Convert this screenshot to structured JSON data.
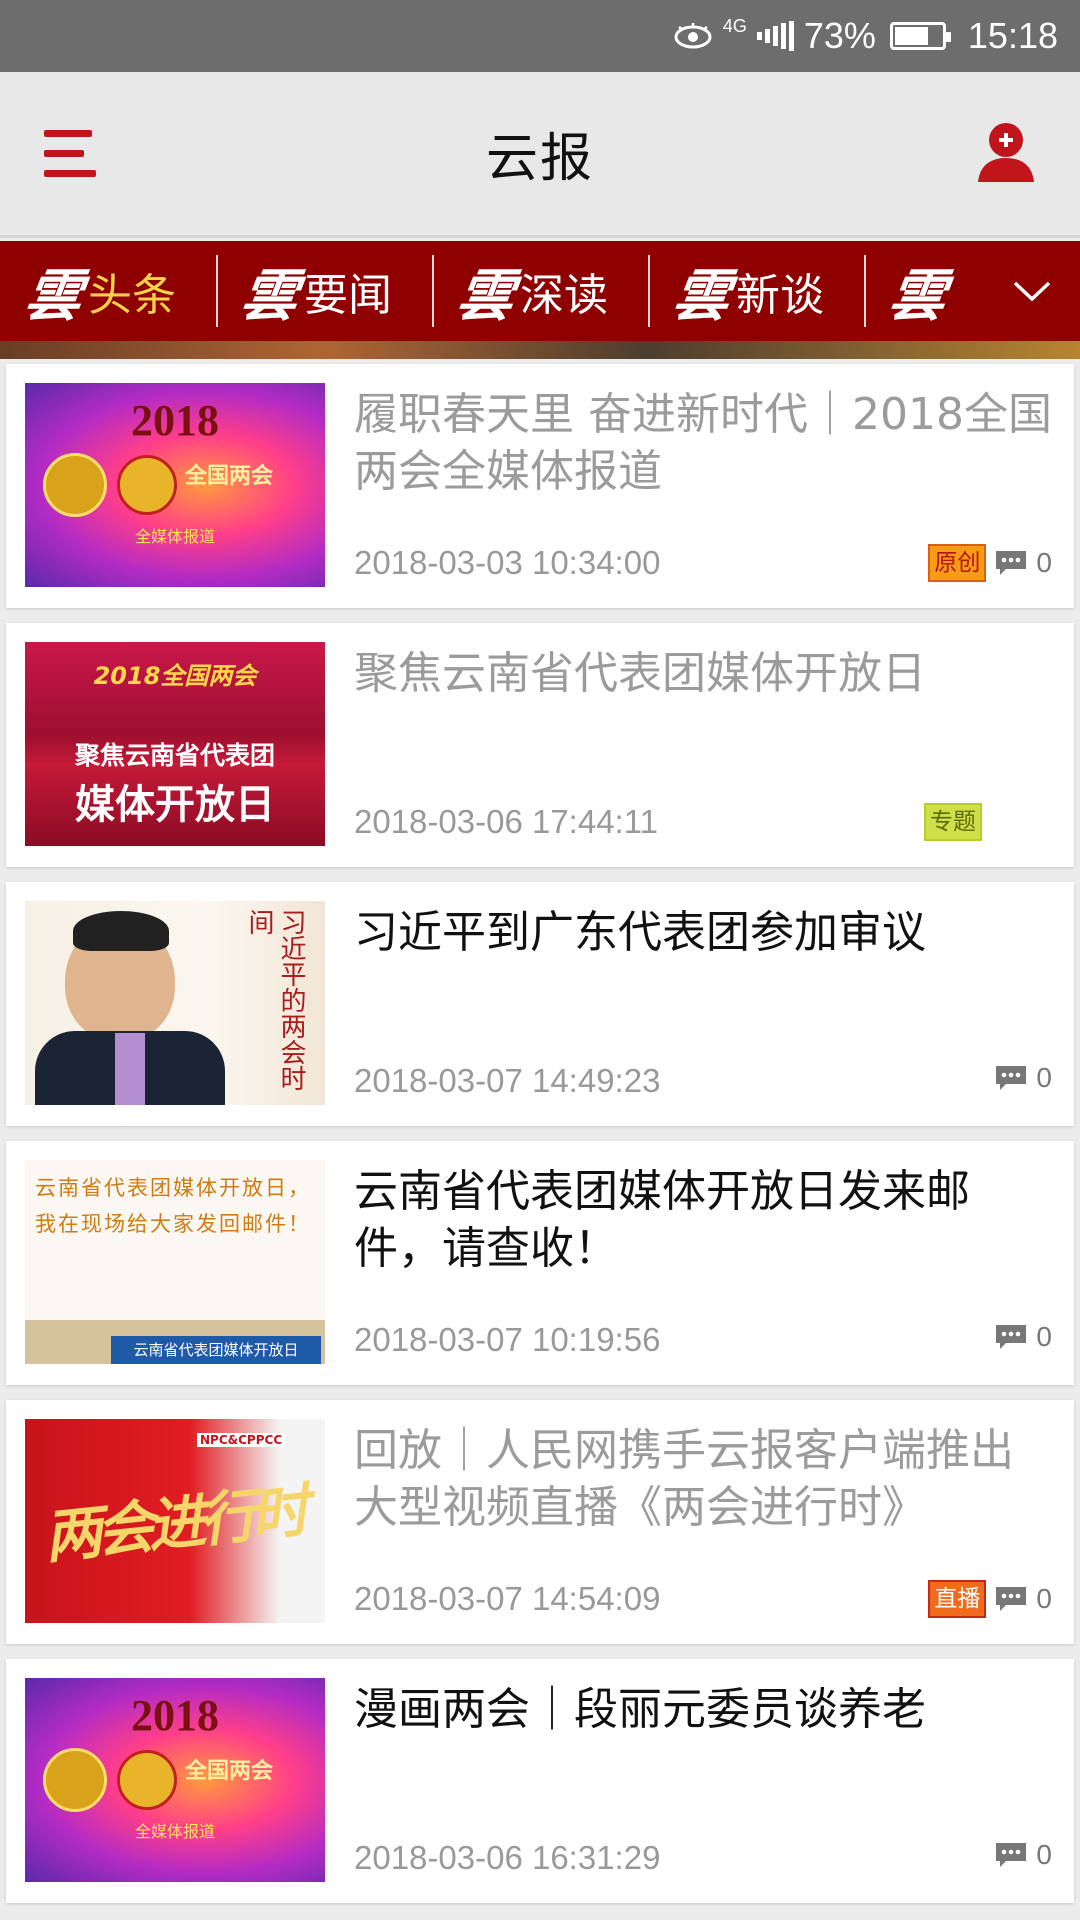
{
  "status": {
    "network": "4G",
    "battery": "73%",
    "time": "15:18",
    "battery_level": 0.73
  },
  "header": {
    "title": "云报"
  },
  "channels": [
    {
      "mark": "雲",
      "label": "头条",
      "active": true
    },
    {
      "mark": "雲",
      "label": "要闻"
    },
    {
      "mark": "雲",
      "label": "深读"
    },
    {
      "mark": "雲",
      "label": "新谈"
    },
    {
      "mark": "雲",
      "label": ""
    }
  ],
  "articles": [
    {
      "title": "履职春天里 奋进新时代｜2018全国两会全媒体报道",
      "date": "2018-03-03 10:34:00",
      "tag": "原创",
      "comments": "0",
      "read": true,
      "thumb": {
        "kind": "lianghui",
        "line1": "2018",
        "line2": "全国两会",
        "line3": "全媒体报道"
      }
    },
    {
      "title": "聚焦云南省代表团媒体开放日",
      "date": "2018-03-06 17:44:11",
      "tag": "专题",
      "read": true,
      "thumb": {
        "kind": "focus",
        "line1": "2018全国两会",
        "line2": "聚焦云南省代表团",
        "line3": "媒体开放日"
      }
    },
    {
      "title": "习近平到广东代表团参加审议",
      "date": "2018-03-07 14:49:23",
      "comments": "0",
      "read": false,
      "thumb": {
        "kind": "portrait",
        "line1": "习近平的两会时间"
      }
    },
    {
      "title": "云南省代表团媒体开放日发来邮件，请查收！",
      "date": "2018-03-07 10:19:56",
      "comments": "0",
      "read": false,
      "thumb": {
        "kind": "mail",
        "line1": "云南省代表团媒体开放日，我在现场给大家发回邮件！",
        "line2": "云南省代表团媒体开放日"
      }
    },
    {
      "title": "回放｜人民网携手云报客户端推出大型视频直播《两会进行时》",
      "date": "2018-03-07 14:54:09",
      "tag": "直播",
      "comments": "0",
      "read": true,
      "thumb": {
        "kind": "jinxing",
        "line1": "两会进行时",
        "line2": "NPC&CPPCC"
      }
    },
    {
      "title": "漫画两会｜段丽元委员谈养老",
      "date": "2018-03-06 16:31:29",
      "comments": "0",
      "read": false,
      "thumb": {
        "kind": "lianghui",
        "line1": "2018",
        "line2": "全国两会",
        "line3": "全媒体报道"
      }
    }
  ],
  "colors": {
    "brand_red": "#8f0000",
    "accent": "#c0151b",
    "active_channel": "#f8d34a"
  }
}
